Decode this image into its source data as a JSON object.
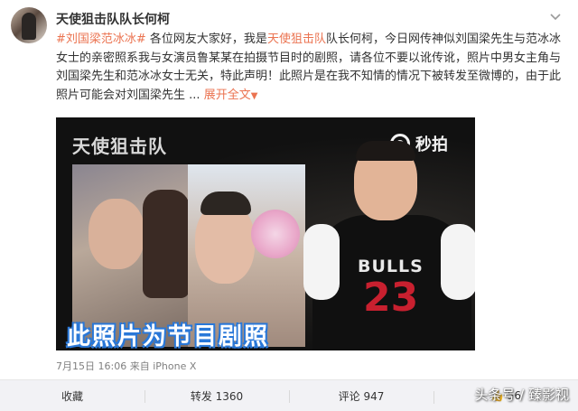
{
  "post": {
    "author": "天使狙击队队长何柯",
    "hashtag": "#刘国梁范冰冰#",
    "text_before_mention": " 各位网友大家好，我是",
    "mention": "天使狙击队",
    "text_after_mention": "队长何柯，今日网传神似刘国梁先生与范冰冰女士的亲密照系我与女演员鲁某某在拍摄节目时的剧照，请各位不要以讹传讹，照片中男女主角与刘国梁先生和范冰冰女士无关，特此声明！此照片是在我不知情的情况下被转发至微博的，由于此照片可能会对刘国梁先生",
    "ellipsis": " ...",
    "expand_label": "展开全文",
    "expand_icon": "chevron-down-icon",
    "timestamp": "7月15日 16:06",
    "source_prefix": "来自",
    "source": "iPhone X"
  },
  "media": {
    "show_logo": "天使狙击队",
    "watermark_app": "秒拍",
    "caption": "此照片为节目剧照",
    "jersey_team": "BULLS",
    "jersey_number": "23"
  },
  "actions": {
    "favorite": "收藏",
    "repost": "转发 1360",
    "comment": "评论 947",
    "like": "56"
  },
  "watermark": "头条号 / 臻影视",
  "colors": {
    "accent": "#eb7350",
    "caption_outline": "#2a78d8",
    "action_bar_bg": "#f2f2f5"
  }
}
